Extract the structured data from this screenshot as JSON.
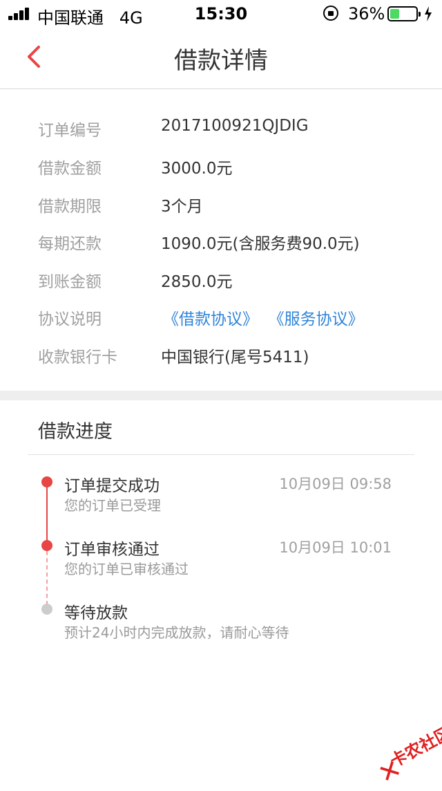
{
  "status_bar": {
    "carrier": "中国联通",
    "network": "4G",
    "time": "15:30",
    "battery_percent": "36%",
    "battery_level": 0.36,
    "battery_color": "#4cd964"
  },
  "nav": {
    "title": "借款详情",
    "back_icon": "chevron-left-icon",
    "accent_color": "#e84545"
  },
  "details": {
    "rows": [
      {
        "label": "订单编号",
        "value": "2017100921QJDIG"
      },
      {
        "label": "借款金额",
        "value": "3000.0元"
      },
      {
        "label": "借款期限",
        "value": "3个月"
      },
      {
        "label": "每期还款",
        "value": "1090.0元(含服务费90.0元)"
      },
      {
        "label": "到账金额",
        "value": "2850.0元"
      },
      {
        "label": "协议说明",
        "links": [
          "《借款协议》",
          "《服务协议》"
        ]
      },
      {
        "label": "收款银行卡",
        "value": "中国银行(尾号5411)"
      }
    ],
    "link_color": "#2f84d8"
  },
  "progress": {
    "title": "借款进度",
    "steps": [
      {
        "title": "订单提交成功",
        "subtitle": "您的订单已受理",
        "time": "10月09日 09:58",
        "status": "done"
      },
      {
        "title": "订单审核通过",
        "subtitle": "您的订单已审核通过",
        "time": "10月09日 10:01",
        "status": "done"
      },
      {
        "title": "等待放款",
        "subtitle": "预计24小时内完成放款，请耐心等待",
        "time": "",
        "status": "pending"
      }
    ]
  },
  "watermark": {
    "text": "卡农社区"
  }
}
